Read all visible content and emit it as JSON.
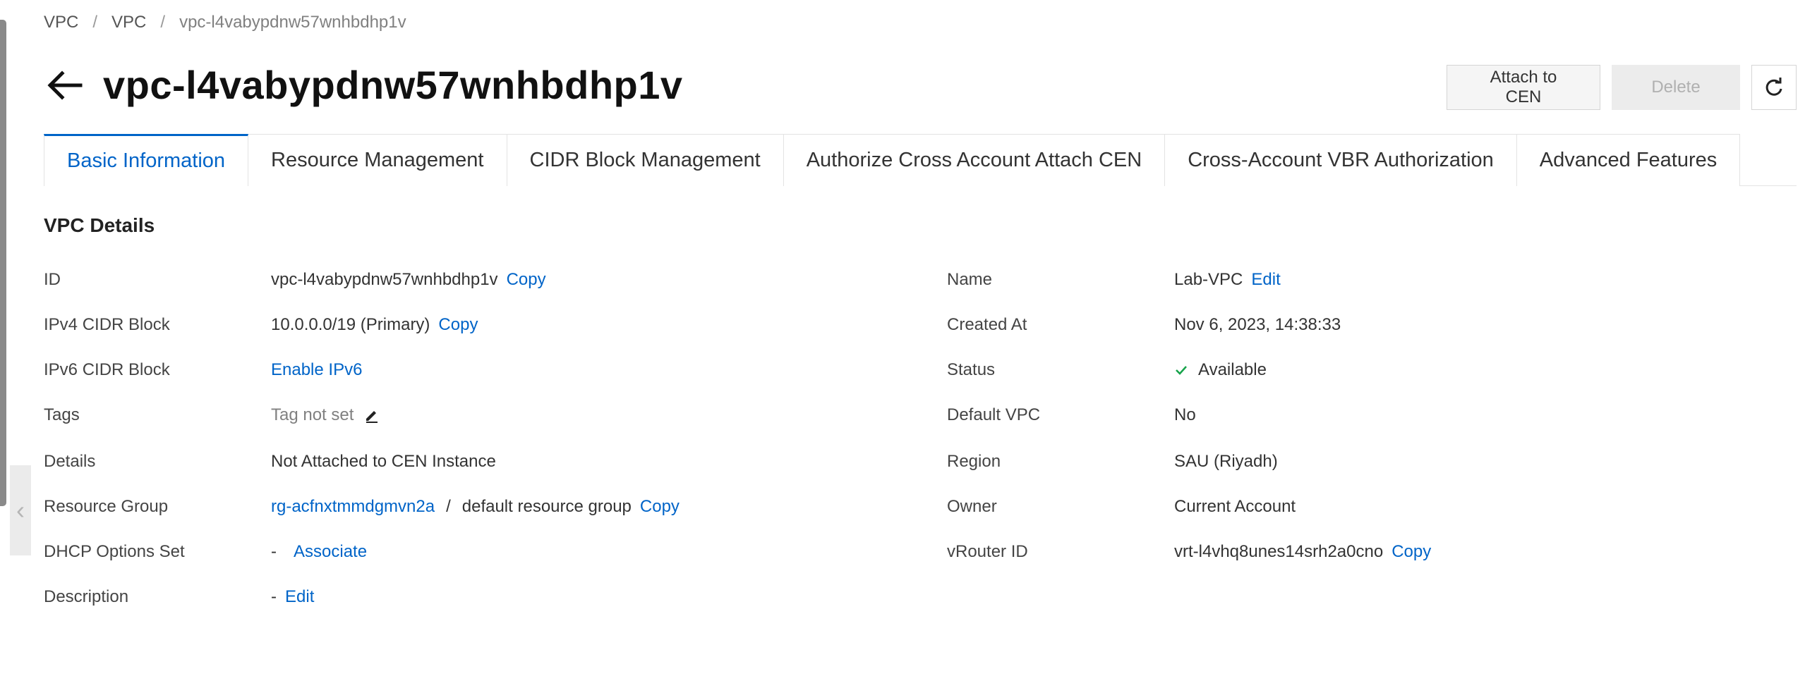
{
  "breadcrumb": [
    "VPC",
    "VPC",
    "vpc-l4vabypdnw57wnhbdhp1v"
  ],
  "breadcrumb_separator": "/",
  "page_title": "vpc-l4vabypdnw57wnhbdhp1v",
  "actions": {
    "attach": "Attach to CEN",
    "delete": "Delete",
    "refresh_icon": "refresh-icon"
  },
  "tabs": [
    {
      "label": "Basic Information",
      "active": true
    },
    {
      "label": "Resource Management",
      "active": false
    },
    {
      "label": "CIDR Block Management",
      "active": false
    },
    {
      "label": "Authorize Cross Account Attach CEN",
      "active": false
    },
    {
      "label": "Cross-Account VBR Authorization",
      "active": false
    },
    {
      "label": "Advanced Features",
      "active": false
    }
  ],
  "section_title": "VPC Details",
  "left": {
    "id": {
      "label": "ID",
      "value": "vpc-l4vabypdnw57wnhbdhp1v",
      "action": "Copy"
    },
    "ipv4": {
      "label": "IPv4 CIDR Block",
      "value": "10.0.0.0/19 (Primary)",
      "action": "Copy"
    },
    "ipv6": {
      "label": "IPv6 CIDR Block",
      "action": "Enable IPv6"
    },
    "tags": {
      "label": "Tags",
      "value": "Tag not set",
      "icon": "pencil-icon"
    },
    "details": {
      "label": "Details",
      "value": "Not Attached to CEN Instance"
    },
    "resource_group": {
      "label": "Resource Group",
      "link": "rg-acfnxtmmdgmvn2a",
      "sep": "/",
      "value": "default resource group",
      "action": "Copy"
    },
    "dhcp": {
      "label": "DHCP Options Set",
      "value": "-",
      "action": "Associate"
    },
    "description": {
      "label": "Description",
      "value": "-",
      "action": "Edit"
    }
  },
  "right": {
    "name": {
      "label": "Name",
      "value": "Lab-VPC",
      "action": "Edit"
    },
    "created": {
      "label": "Created At",
      "value": "Nov 6, 2023, 14:38:33"
    },
    "status": {
      "label": "Status",
      "value": "Available",
      "icon": "check-icon",
      "color": "#16a34a"
    },
    "default_vpc": {
      "label": "Default VPC",
      "value": "No"
    },
    "region": {
      "label": "Region",
      "value": "SAU (Riyadh)"
    },
    "owner": {
      "label": "Owner",
      "value": "Current Account"
    },
    "vrouter": {
      "label": "vRouter ID",
      "value": "vrt-l4vhq8unes14srh2a0cno",
      "action": "Copy"
    }
  },
  "colors": {
    "link": "#0064c8",
    "active_tab": "#0064c8"
  }
}
